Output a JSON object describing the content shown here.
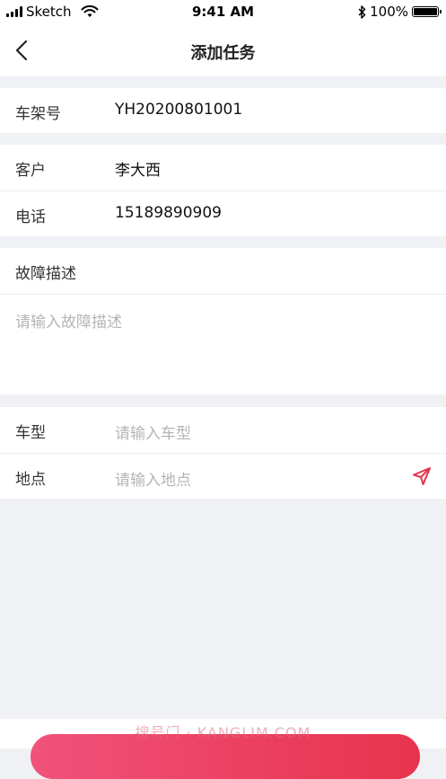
{
  "status_bar": {
    "carrier": "Sketch",
    "time": "9:41 AM",
    "battery_percent": "100%",
    "battery_level": 1.0
  },
  "nav": {
    "title": "添加任务"
  },
  "form": {
    "vin": {
      "label": "车架号",
      "value": "YH20200801001"
    },
    "customer": {
      "label": "客户",
      "value": "李大西"
    },
    "phone": {
      "label": "电话",
      "value": "15189890909"
    },
    "fault": {
      "label": "故障描述",
      "placeholder": "请输入故障描述"
    },
    "car_model": {
      "label": "车型",
      "placeholder": "请输入车型"
    },
    "location": {
      "label": "地点",
      "placeholder": "请输入地点"
    }
  },
  "watermark": "搜号门 · KANGLIM.COM",
  "colors": {
    "accent": "#e8334d",
    "background": "#f0f1f5"
  },
  "icons": [
    "back-icon",
    "location-arrow-icon",
    "wifi-icon",
    "bluetooth-icon",
    "battery-icon",
    "signal-icon"
  ]
}
